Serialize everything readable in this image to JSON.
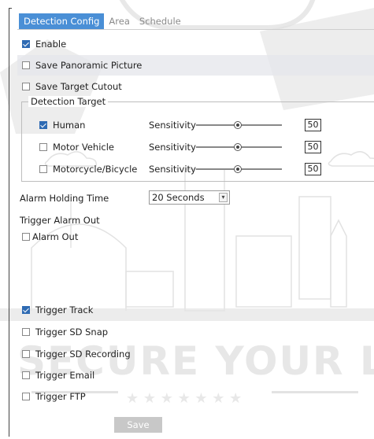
{
  "tabs": [
    {
      "label": "Detection Config",
      "active": true
    },
    {
      "label": "Area",
      "active": false
    },
    {
      "label": "Schedule",
      "active": false
    }
  ],
  "options": {
    "enable": {
      "label": "Enable",
      "checked": true
    },
    "save_panoramic": {
      "label": "Save Panoramic Picture",
      "checked": false
    },
    "save_target_cutout": {
      "label": "Save Target Cutout",
      "checked": false
    }
  },
  "detection_target": {
    "title": "Detection Target",
    "sensitivity_label": "Sensitivity",
    "targets": [
      {
        "label": "Human",
        "checked": true,
        "sensitivity": 50
      },
      {
        "label": "Motor Vehicle",
        "checked": false,
        "sensitivity": 50
      },
      {
        "label": "Motorcycle/Bicycle",
        "checked": false,
        "sensitivity": 50
      }
    ]
  },
  "alarm_holding": {
    "label": "Alarm Holding Time",
    "value": "20 Seconds"
  },
  "trigger_alarm_out": {
    "title": "Trigger Alarm Out",
    "alarm_out": {
      "label": "Alarm Out",
      "checked": false
    }
  },
  "triggers": {
    "track": {
      "label": "Trigger Track",
      "checked": true
    },
    "sd_snap": {
      "label": "Trigger SD Snap",
      "checked": false
    },
    "sd_recording": {
      "label": "Trigger SD Recording",
      "checked": false
    },
    "email": {
      "label": "Trigger Email",
      "checked": false
    },
    "ftp": {
      "label": "Trigger FTP",
      "checked": false
    }
  },
  "save_label": "Save",
  "watermark_text": "SECURE YOUR L",
  "colors": {
    "active_tab": "#4a8fd6",
    "save_button": "#c8c8c8",
    "checkbox_checked": "#2f6bb3"
  }
}
